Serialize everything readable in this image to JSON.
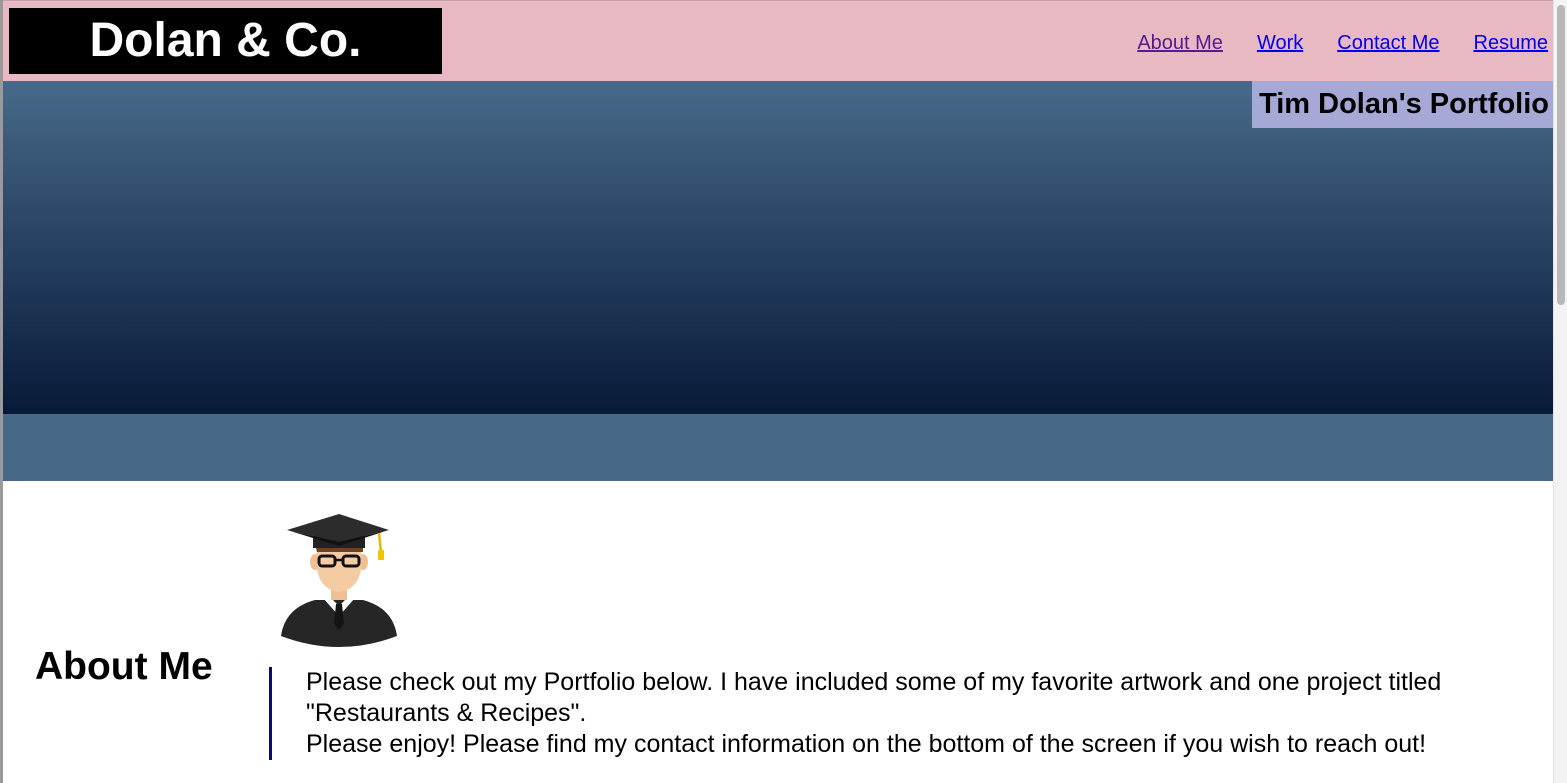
{
  "header": {
    "logo_text": "Dolan & Co.",
    "nav": [
      {
        "label": "About Me",
        "visited": true
      },
      {
        "label": "Work",
        "visited": false
      },
      {
        "label": "Contact Me",
        "visited": false
      },
      {
        "label": "Resume",
        "visited": false
      }
    ]
  },
  "hero": {
    "title": "Tim Dolan's Portfolio"
  },
  "about": {
    "heading": "About Me",
    "avatar_icon": "graduate-avatar-icon",
    "paragraph_line1": "Please check out my Portfolio below. I have included some of my favorite artwork and one project titled \"Restaurants & Recipes\".",
    "paragraph_line2": "Please enjoy! Please find my contact information on the bottom of the screen if you wish to reach out!"
  },
  "colors": {
    "header_bg": "#e8b9c3",
    "logo_bg": "#000000",
    "title_bg": "#a6a9d6",
    "hero_top": "#486a8a",
    "hero_bottom": "#071a38",
    "band": "#476887",
    "quote_border": "#0a0a6e"
  }
}
